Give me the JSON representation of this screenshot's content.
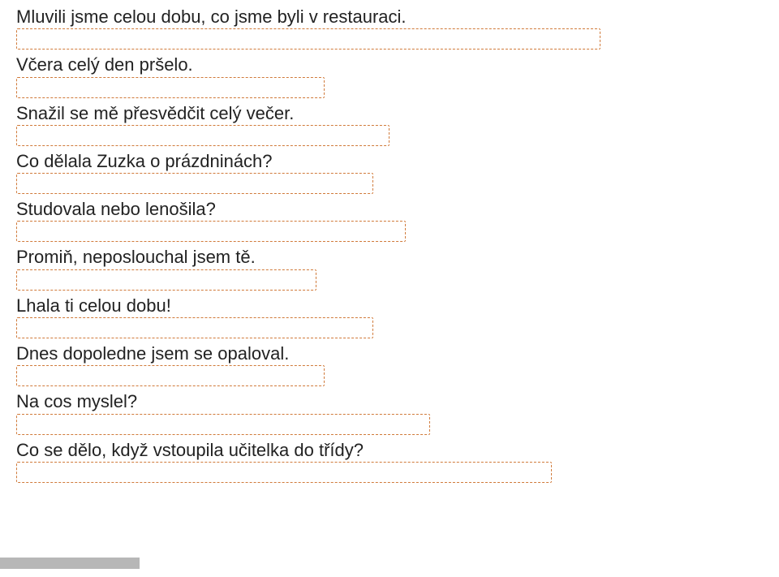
{
  "items": [
    {
      "prompt": "Mluvili jsme celou dobu, co jsme byli v restauraci.",
      "box_width": "w-720"
    },
    {
      "prompt": "Včera celý den pršelo.",
      "box_width": "w-380"
    },
    {
      "prompt": "Snažil se mě přesvědčit celý večer.",
      "box_width": "w-460"
    },
    {
      "prompt": "Co dělala Zuzka o prázdninách?",
      "box_width": "w-440"
    },
    {
      "prompt": "Studovala nebo lenošila?",
      "box_width": "w-480"
    },
    {
      "prompt": "Promiň, neposlouchal jsem tě.",
      "box_width": "w-370"
    },
    {
      "prompt": "Lhala ti celou dobu!",
      "box_width": "w-440"
    },
    {
      "prompt": "Dnes dopoledne jsem se opaloval.",
      "box_width": "w-380"
    },
    {
      "prompt": "Na cos myslel?",
      "box_width": "w-510"
    },
    {
      "prompt": "Co se dělo, když vstoupila učitelka do třídy?",
      "box_width": "w-660"
    }
  ]
}
